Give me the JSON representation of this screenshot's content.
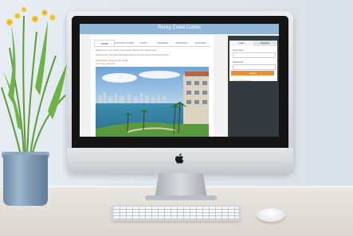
{
  "scene": {
    "description_objects": [
      "monitor",
      "plant",
      "keyboard",
      "mouse"
    ]
  },
  "site": {
    "title": "Rocky Creek Condo",
    "tabs": [
      "HOME",
      "CONTACT FORM",
      "UNITS",
      "OWNERS",
      "SERVICES",
      "POLICIES"
    ],
    "intro_lines": [
      "Welcome to our online community. Bring new owners info.",
      "Owners can now find all board and community forms and documents.",
      "Click here to access our portal",
      "Join now - It's free"
    ]
  },
  "sidebar": {
    "tabs": [
      "Login",
      "Register"
    ],
    "username_label": "Username",
    "password_label": "Password",
    "login_button": "Log In",
    "forgot_link": "Forgot Password"
  },
  "colors": {
    "header": "#8fb6d9",
    "sidebar": "#333a40",
    "button": "#e8913a"
  }
}
